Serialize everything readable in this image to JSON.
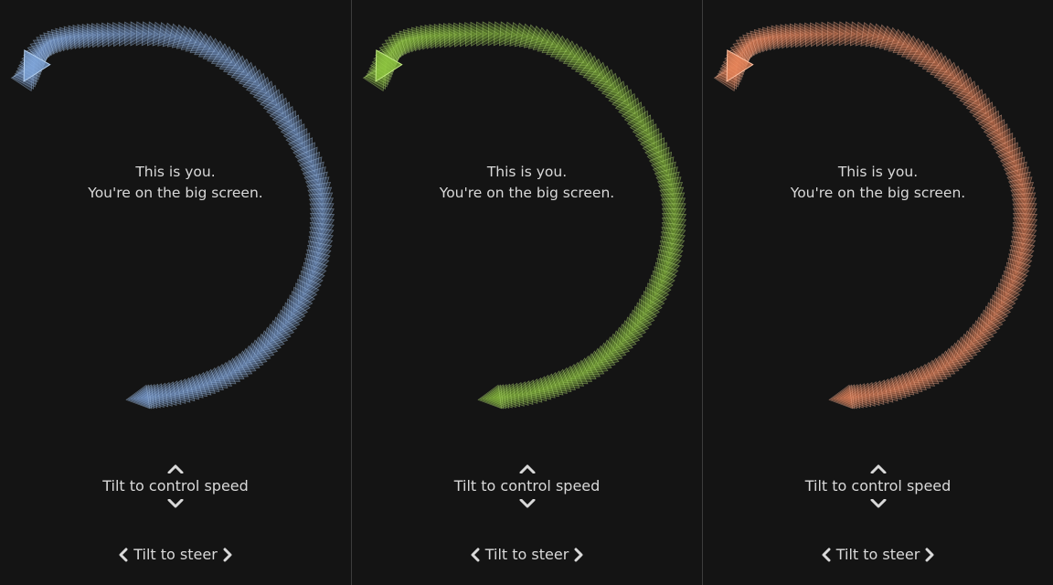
{
  "panels": [
    {
      "color_name": "blue",
      "ship_color": "#7fa6d9",
      "ship_edge": "#b4d0f0",
      "caption_line1": "This is you.",
      "caption_line2": "You're on the big screen.",
      "speed_hint": "Tilt to control speed",
      "steer_hint": "Tilt to steer"
    },
    {
      "color_name": "green",
      "ship_color": "#8dc63f",
      "ship_edge": "#c4ec84",
      "caption_line1": "This is you.",
      "caption_line2": "You're on the big screen.",
      "speed_hint": "Tilt to control speed",
      "steer_hint": "Tilt to steer"
    },
    {
      "color_name": "orange",
      "ship_color": "#e8865a",
      "ship_edge": "#ffc2a3",
      "caption_line1": "This is you.",
      "caption_line2": "You're on the big screen.",
      "speed_hint": "Tilt to control speed",
      "steer_hint": "Tilt to steer"
    }
  ]
}
